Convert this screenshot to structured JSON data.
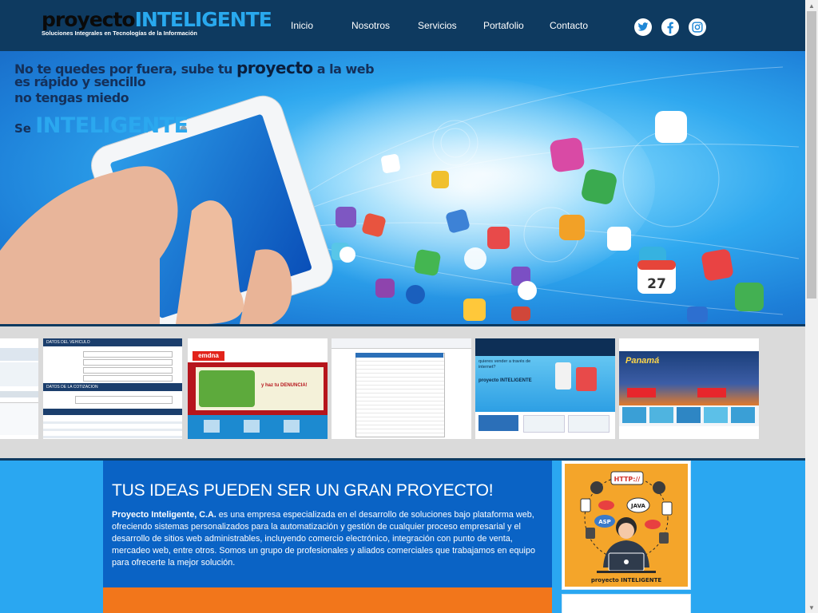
{
  "header": {
    "logo": {
      "part1": "proyecto",
      "part2": "INTELIGENTE",
      "tagline": "Soluciones Integrales en Tecnologías de la Información"
    },
    "nav": [
      {
        "label": "Inicio"
      },
      {
        "label": "Nosotros"
      },
      {
        "label": "Servicios"
      },
      {
        "label": "Portafolio"
      },
      {
        "label": "Contacto"
      }
    ],
    "social": [
      {
        "icon": "twitter-icon"
      },
      {
        "icon": "facebook-icon"
      },
      {
        "icon": "instagram-icon"
      }
    ]
  },
  "hero": {
    "line1_a": "No te quedes por fuera, sube tu ",
    "line1_b": "proyecto",
    "line1_c": " a la web",
    "line2": "es rápido y sencillo",
    "line3": "no tengas miedo",
    "se": "Se ",
    "inteligente": "INTELIGENTE",
    "calendar_day": "27"
  },
  "thumbnails": [
    {
      "title": "",
      "subtitle": ""
    },
    {
      "title": "DATOS DEL VEHICULO",
      "subtitle": "DATOS DE LA COTIZACION"
    },
    {
      "title": "emdna",
      "subtitle": "y haz tu DENUNCIA!"
    },
    {
      "title": "",
      "subtitle": ""
    },
    {
      "title": "quieres vender a través de internet?",
      "subtitle": "proyecto INTELIGENTE"
    },
    {
      "title": "Panamá",
      "subtitle": ""
    }
  ],
  "main": {
    "heading": "TUS IDEAS PUEDEN SER UN GRAN PROYECTO!",
    "company": "Proyecto Inteligente, C.A.",
    "body": " es una empresa especializada en el desarrollo de soluciones bajo plataforma web, ofreciendo sistemas personalizados para la automatización y gestión de cualquier proceso empresarial y el desarrollo de sitios web administrables, incluyendo comercio electrónico, integración con punto de venta, mercadeo web, entre otros. Somos un grupo de profesionales y aliados comerciales que trabajamos en equipo para ofrecerte la mejor solución.",
    "card": {
      "http": "HTTP://",
      "java": "JAVA",
      "asp": "ASP",
      "logo": "proyecto INTELIGENTE"
    }
  },
  "colors": {
    "header": "#0e3a60",
    "accent": "#2aa7f1",
    "panel": "#0a63c5",
    "orange": "#f2761b"
  }
}
